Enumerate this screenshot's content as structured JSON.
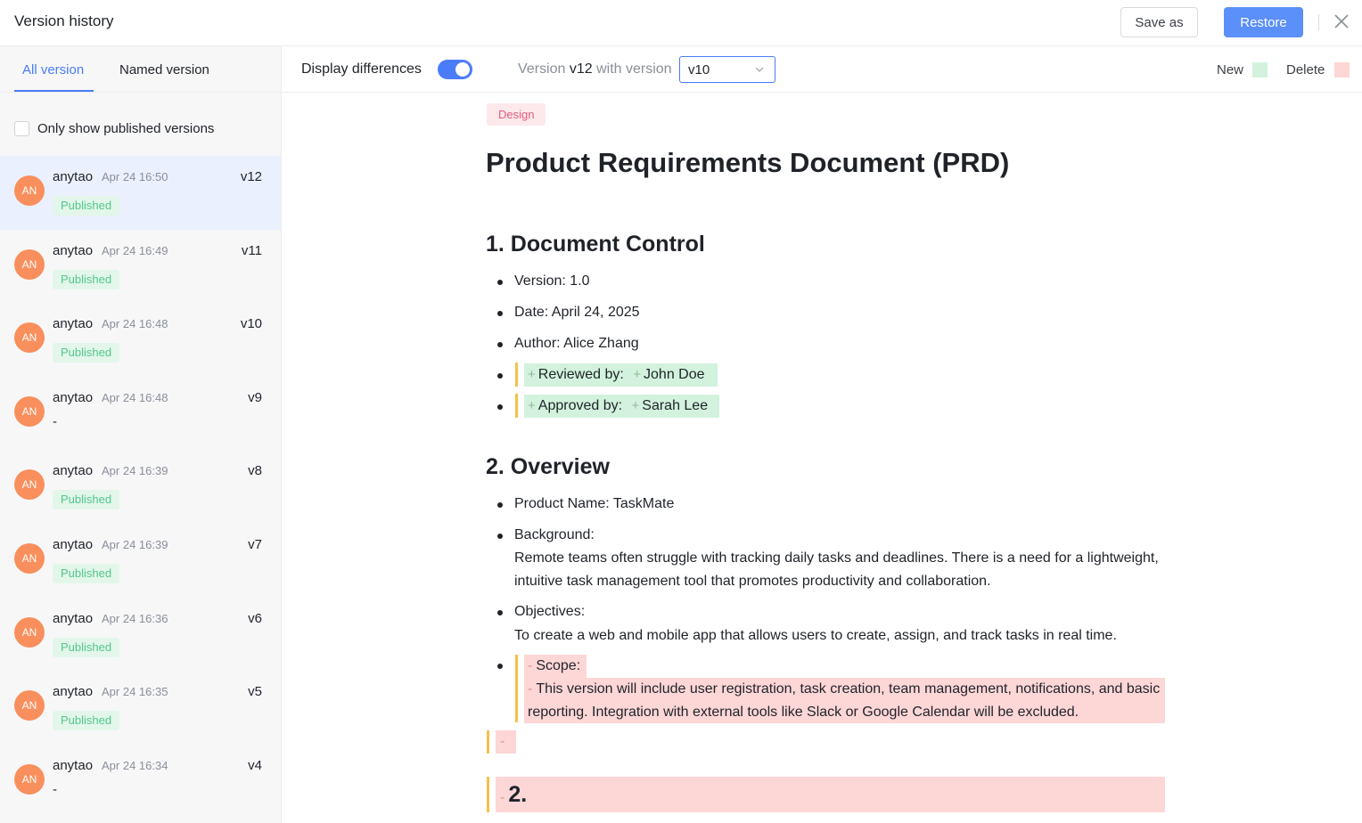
{
  "header": {
    "title": "Version history",
    "save_as": "Save as",
    "restore": "Restore"
  },
  "sidebar": {
    "tabs": [
      "All version",
      "Named version"
    ],
    "only_published": "Only show published versions",
    "versions": [
      {
        "avatar": "AN",
        "author": "anytao",
        "time": "Apr 24 16:50",
        "version": "v12",
        "status": "Published"
      },
      {
        "avatar": "AN",
        "author": "anytao",
        "time": "Apr 24 16:49",
        "version": "v11",
        "status": "Published"
      },
      {
        "avatar": "AN",
        "author": "anytao",
        "time": "Apr 24 16:48",
        "version": "v10",
        "status": "Published"
      },
      {
        "avatar": "AN",
        "author": "anytao",
        "time": "Apr 24 16:48",
        "version": "v9",
        "status": "-"
      },
      {
        "avatar": "AN",
        "author": "anytao",
        "time": "Apr 24 16:39",
        "version": "v8",
        "status": "Published"
      },
      {
        "avatar": "AN",
        "author": "anytao",
        "time": "Apr 24 16:39",
        "version": "v7",
        "status": "Published"
      },
      {
        "avatar": "AN",
        "author": "anytao",
        "time": "Apr 24 16:36",
        "version": "v6",
        "status": "Published"
      },
      {
        "avatar": "AN",
        "author": "anytao",
        "time": "Apr 24 16:35",
        "version": "v5",
        "status": "Published"
      },
      {
        "avatar": "AN",
        "author": "anytao",
        "time": "Apr 24 16:34",
        "version": "v4",
        "status": "-"
      }
    ]
  },
  "toolbar": {
    "display_differences": "Display differences",
    "compare_prefix": "Version",
    "current_version": "v12",
    "compare_middle": "with version",
    "compare_value": "v10",
    "legend_new": "New",
    "legend_delete": "Delete"
  },
  "doc": {
    "tag": "Design",
    "title": "Product Requirements Document (PRD)",
    "section1": "1. Document Control",
    "version_line": "Version: 1.0",
    "date_line": "Date: April 24, 2025",
    "author_line": "Author: Alice Zhang",
    "reviewed_label": "Reviewed by:",
    "reviewed_name": "John Doe",
    "approved_label": "Approved by:",
    "approved_name": "Sarah Lee",
    "section2": "2. Overview",
    "product_name": "Product Name: TaskMate",
    "background_label": "Background:",
    "background_text": "Remote teams often struggle with tracking daily tasks and deadlines. There is a need for a lightweight, intuitive task management tool that promotes productivity and collaboration.",
    "objectives_label": "Objectives:",
    "objectives_text": "To create a web and mobile app that allows users to create, assign, and track tasks in real time.",
    "scope_label": "Scope:",
    "scope_text": "This version will include user registration, task creation, team management, notifications, and basic reporting. Integration with external tools like Slack or Google Calendar will be excluded.",
    "deleted_heading": "2."
  }
}
